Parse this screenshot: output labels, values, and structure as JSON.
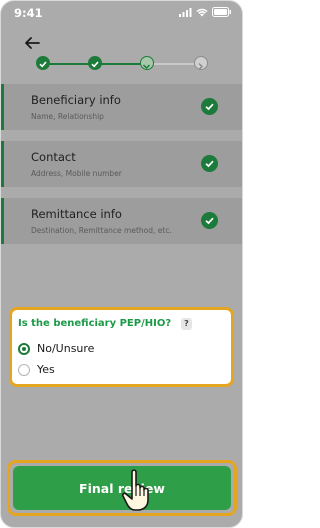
{
  "status_bar": {
    "time": "9:41"
  },
  "steps": [
    "done",
    "done",
    "current",
    "pending"
  ],
  "sections": [
    {
      "title": "Beneficiary info",
      "subtitle": "Name, Relationship"
    },
    {
      "title": "Contact",
      "subtitle": "Address, Mobile number"
    },
    {
      "title": "Remittance info",
      "subtitle": "Destination, Remittance method, etc."
    }
  ],
  "pep_question": {
    "question": "Is the beneficiary PEP/HIO?",
    "help": "?",
    "options": [
      {
        "label": "No/Unsure",
        "selected": true
      },
      {
        "label": "Yes",
        "selected": false
      }
    ]
  },
  "final_button": {
    "label": "Final review"
  },
  "colors": {
    "brand_green": "#1c7a3a",
    "button_green": "#2f9e48",
    "highlight": "#e6a51e"
  }
}
